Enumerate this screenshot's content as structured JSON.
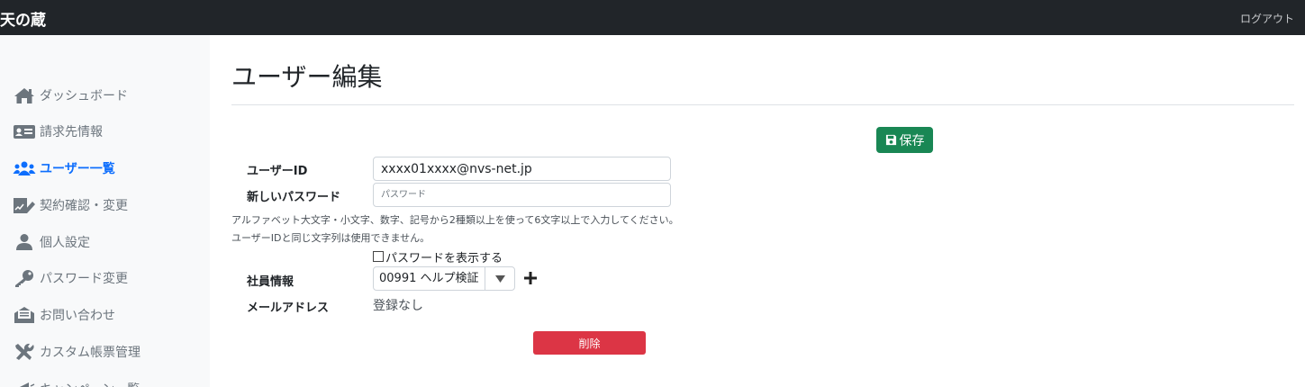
{
  "app": {
    "title": "天の蔵",
    "logout_label": "ログアウト"
  },
  "sidebar": {
    "items": [
      {
        "label": "ダッシュボード",
        "icon": "home-icon",
        "active": false
      },
      {
        "label": "請求先情報",
        "icon": "id-card-icon",
        "active": false
      },
      {
        "label": "ユーザー一覧",
        "icon": "users-icon",
        "active": true
      },
      {
        "label": "契約確認・変更",
        "icon": "contract-sign-icon",
        "active": false
      },
      {
        "label": "個人設定",
        "icon": "user-icon",
        "active": false
      },
      {
        "label": "パスワード変更",
        "icon": "key-icon",
        "active": false
      },
      {
        "label": "お問い合わせ",
        "icon": "envelope-open-icon",
        "active": false
      },
      {
        "label": "カスタム帳票管理",
        "icon": "tools-icon",
        "active": false
      },
      {
        "label": "キャンペーン一覧",
        "icon": "megaphone-icon",
        "active": false
      }
    ]
  },
  "colors": {
    "active": "#0d6efd",
    "inactive": "#6c757d",
    "save": "#198754",
    "delete": "#dc3545",
    "topbar": "#212529"
  },
  "main": {
    "title": "ユーザー編集",
    "save_label": "保存",
    "user_id": {
      "label": "ユーザーID",
      "value": "xxxx01xxxx@nvs-net.jp"
    },
    "password": {
      "label": "新しいパスワード",
      "placeholder": "パスワード"
    },
    "help_text_1": "アルファベット大文字・小文字、数字、記号から2種類以上を使って6文字以上で入力してください。",
    "help_text_2": "ユーザーIDと同じ文字列は使用できません。",
    "show_password_label": "パスワードを表示する",
    "employee": {
      "label": "社員情報",
      "value": "00991 ヘルプ検証"
    },
    "email": {
      "label": "メールアドレス",
      "value": "登録なし"
    },
    "delete_label": "削除"
  }
}
